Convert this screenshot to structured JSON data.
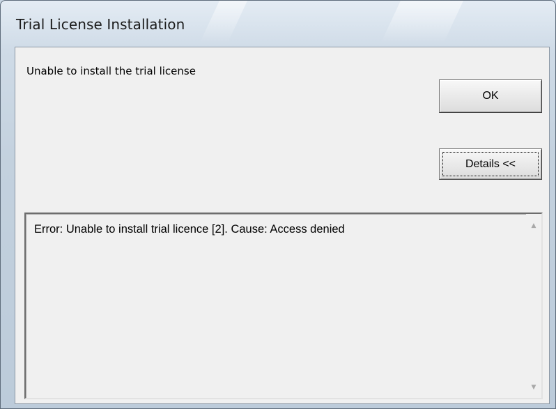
{
  "window": {
    "title": "Trial License Installation"
  },
  "dialog": {
    "message": "Unable to install the trial license",
    "ok_label": "OK",
    "details_label": "Details <<",
    "details_text": "Error: Unable to install trial licence [2]. Cause: Access denied"
  },
  "scrollbar": {
    "up_glyph": "▲",
    "down_glyph": "▼"
  },
  "colors": {
    "client_background": "#f0f0f0",
    "frame": "#c3d1de",
    "text": "#000000"
  }
}
